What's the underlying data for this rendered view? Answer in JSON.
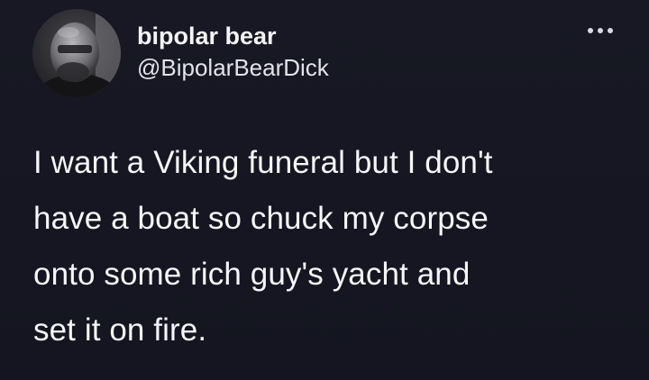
{
  "tweet": {
    "author": {
      "display_name": "bipolar bear",
      "handle": "@BipolarBearDick",
      "avatar_icon": "avatar-photo"
    },
    "more_icon": "more-horizontal-icon",
    "text_lines": [
      "I want a Viking funeral but I don't",
      "have a boat so chuck my corpse",
      "onto some rich guy's yacht and",
      "set it on fire."
    ]
  },
  "colors": {
    "background": "#161722",
    "text": "#f2f3f5"
  }
}
